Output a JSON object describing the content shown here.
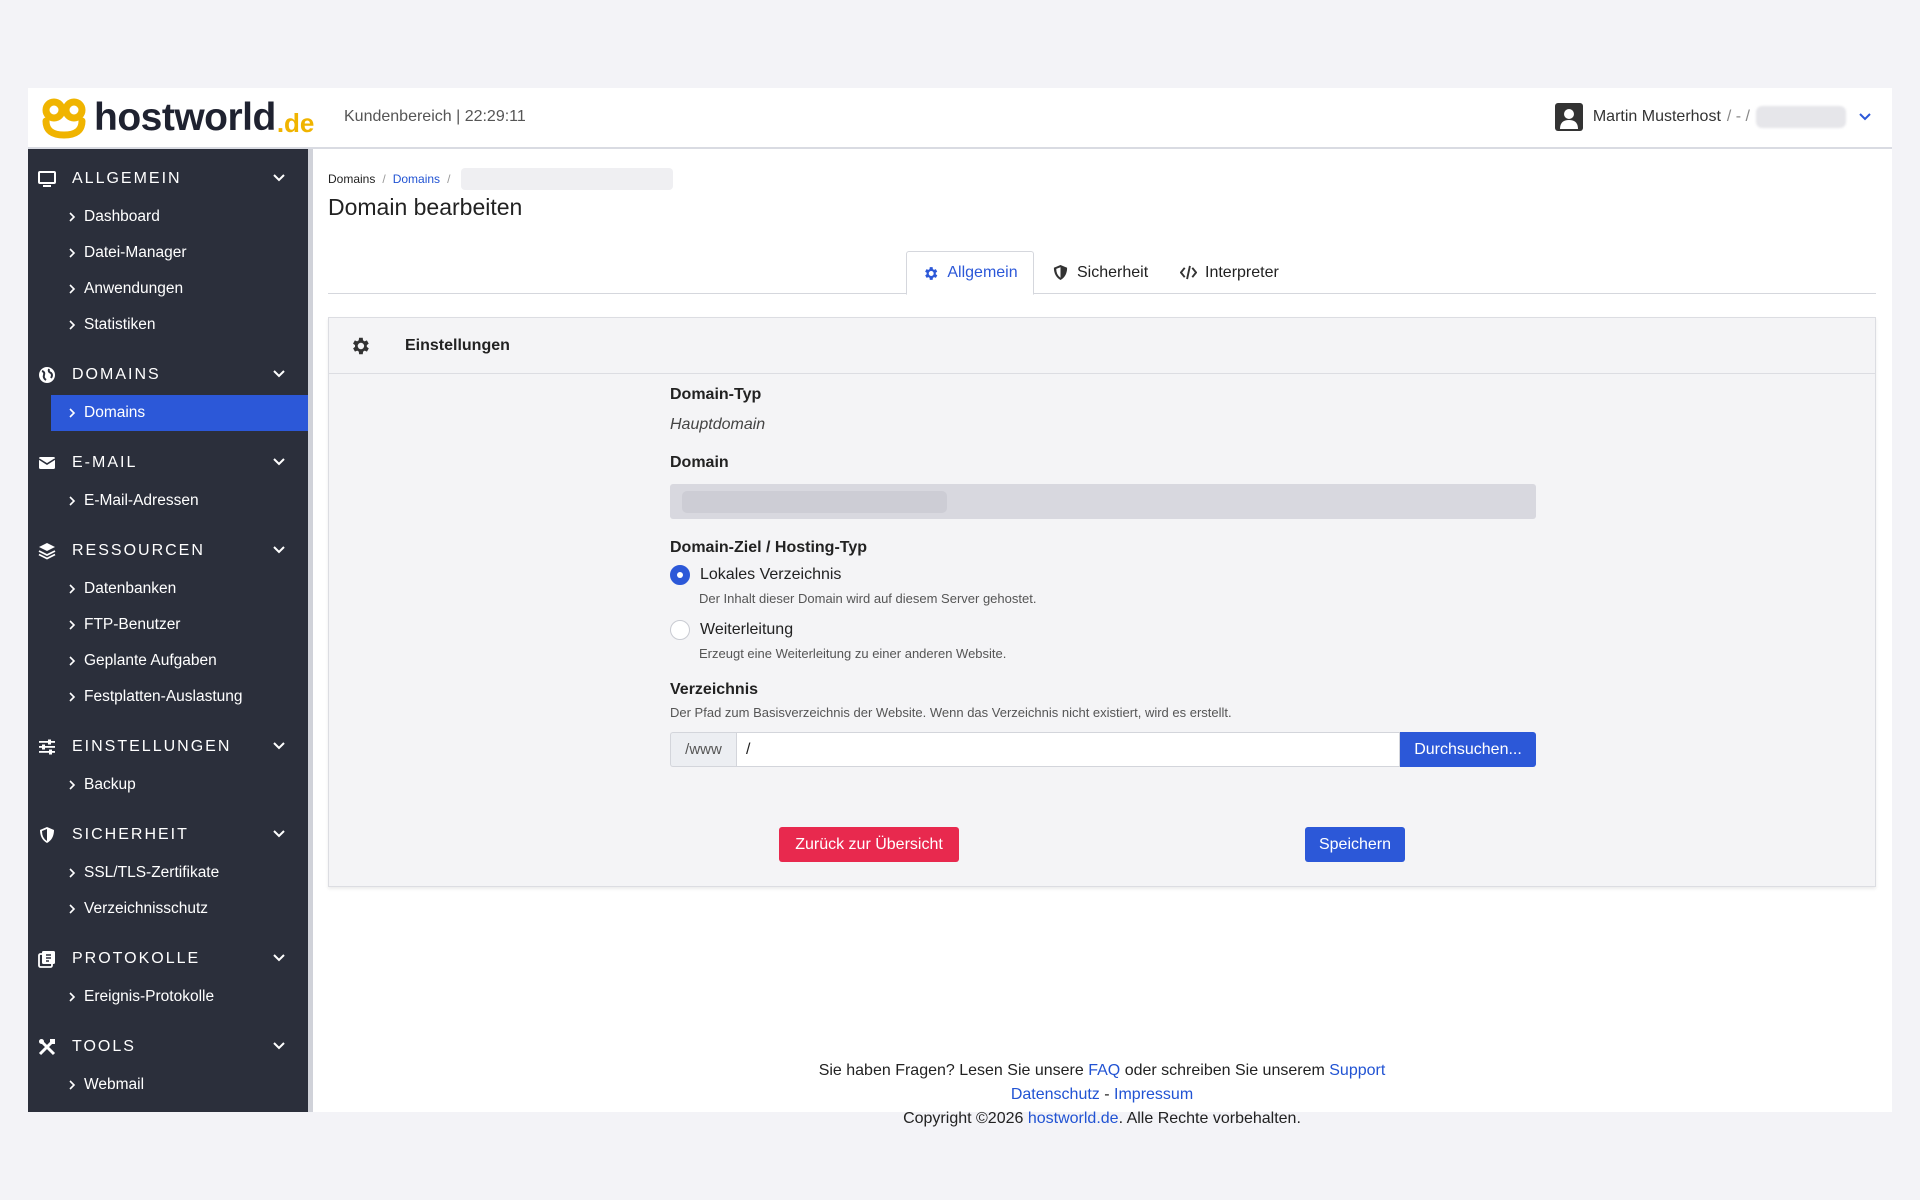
{
  "header": {
    "brand": "hostworld",
    "tld": ".de",
    "portal_label": "Kundenbereich | 22:29:11",
    "user_name": "Martin Musterhost",
    "user_sep": "/ - /"
  },
  "sidebar": {
    "sections": [
      {
        "title": "ALLGEMEIN",
        "icon": "monitor-icon",
        "items": [
          "Dashboard",
          "Datei-Manager",
          "Anwendungen",
          "Statistiken"
        ]
      },
      {
        "title": "DOMAINS",
        "icon": "globe-icon",
        "items": [
          "Domains"
        ]
      },
      {
        "title": "E-MAIL",
        "icon": "envelope-icon",
        "items": [
          "E-Mail-Adressen"
        ]
      },
      {
        "title": "RESSOURCEN",
        "icon": "layers-icon",
        "items": [
          "Datenbanken",
          "FTP-Benutzer",
          "Geplante Aufgaben",
          "Festplatten-Auslastung"
        ]
      },
      {
        "title": "EINSTELLUNGEN",
        "icon": "sliders-icon",
        "items": [
          "Backup"
        ]
      },
      {
        "title": "SICHERHEIT",
        "icon": "shield-icon",
        "items": [
          "SSL/TLS-Zertifikate",
          "Verzeichnisschutz"
        ]
      },
      {
        "title": "PROTOKOLLE",
        "icon": "log-icon",
        "items": [
          "Ereignis-Protokolle"
        ]
      },
      {
        "title": "TOOLS",
        "icon": "tools-icon",
        "items": [
          "Webmail"
        ]
      }
    ],
    "active_item": "Domains"
  },
  "breadcrumb": {
    "root": "Domains",
    "link": "Domains"
  },
  "page_title": "Domain bearbeiten",
  "tabs": {
    "general": "Allgemein",
    "security": "Sicherheit",
    "interpreter": "Interpreter"
  },
  "card": {
    "title": "Einstellungen",
    "domain_type_label": "Domain-Typ",
    "domain_type_value": "Hauptdomain",
    "domain_label": "Domain",
    "target_label": "Domain-Ziel / Hosting-Typ",
    "option_local": "Lokales Verzeichnis",
    "option_local_help": "Der Inhalt dieser Domain wird auf diesem Server gehostet.",
    "option_redirect": "Weiterleitung",
    "option_redirect_help": "Erzeugt eine Weiterleitung zu einer anderen Website.",
    "directory_label": "Verzeichnis",
    "directory_help": "Der Pfad zum Basisverzeichnis der Website. Wenn das Verzeichnis nicht existiert, wird es erstellt.",
    "directory_prefix": "/www",
    "directory_value": "/",
    "browse_button": "Durchsuchen...",
    "back_button": "Zurück zur Übersicht",
    "save_button": "Speichern"
  },
  "footer": {
    "q_prefix": "Sie haben Fragen? Lesen Sie unsere",
    "faq": "FAQ",
    "q_middle": "oder schreiben Sie unserem",
    "support": "Support",
    "privacy": "Datenschutz",
    "dash": "-",
    "imprint": "Impressum",
    "copy_prefix": "Copyright ©2026",
    "copy_link": "hostworld.de",
    "copy_suffix": ". Alle Rechte vorbehalten."
  },
  "colors": {
    "accent": "#2c58d8",
    "danger": "#e8294e",
    "sidebar": "#2b2f3b",
    "logo": "#f0b400"
  }
}
